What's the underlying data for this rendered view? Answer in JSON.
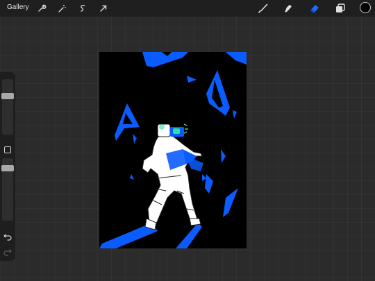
{
  "toolbar": {
    "gallery_label": "Gallery",
    "left_tools": [
      "wrench-icon",
      "magic-wand-icon",
      "selection-icon",
      "transform-arrow-icon"
    ],
    "right_tools": [
      "brush-icon",
      "smudge-icon",
      "eraser-icon",
      "layers-icon",
      "color-swatch"
    ],
    "active_tool": "eraser",
    "accent_color": "#1a6cff",
    "current_color": "#000000"
  },
  "sidebar": {
    "brush_size": 0.8,
    "opacity": 0.75
  },
  "artwork": {
    "description_colors": [
      "#000000",
      "#0b5cff",
      "#ffffff",
      "#2ee0a0"
    ]
  }
}
